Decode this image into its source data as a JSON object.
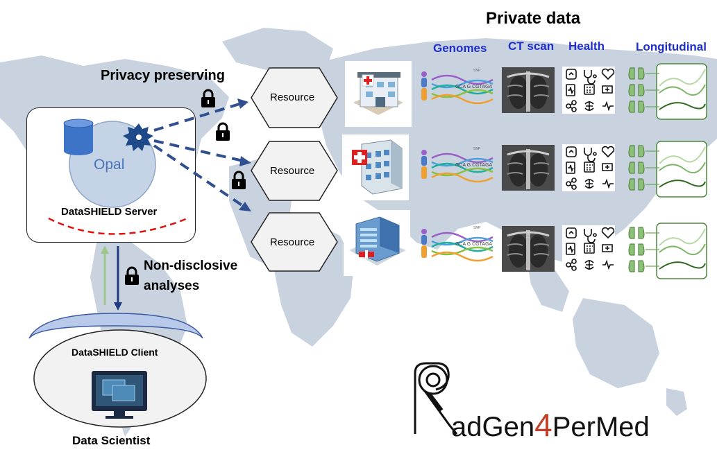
{
  "header": {
    "title": "Private data"
  },
  "columns": {
    "genomes": "Genomes",
    "ct_scan": "CT scan",
    "health": "Health",
    "longitudinal": "Longitudinal"
  },
  "left": {
    "privacy_label": "Privacy preserving",
    "server_db": "Opal",
    "server_label": "DataSHIELD Server",
    "analyses_label_line1": "Non-disclosive",
    "analyses_label_line2": "analyses",
    "client_label": "DataSHIELD Client",
    "scientist_label": "Data Scientist"
  },
  "resources": [
    {
      "label": "Resource"
    },
    {
      "label": "Resource"
    },
    {
      "label": "Resource"
    }
  ],
  "genome_seq": "GCA G CGTAGA",
  "genome_snp": "SNP",
  "logo": {
    "prefix": "adGen",
    "number": "4",
    "suffix": "PerMed"
  },
  "colors": {
    "column_header": "#1f2fcc",
    "arrow_dashed": "#2f4f8f",
    "server_arc": "#e01010",
    "logo_number": "#c0402a",
    "map": "#c9d3df",
    "longitudinal": "#4a8a3a"
  }
}
